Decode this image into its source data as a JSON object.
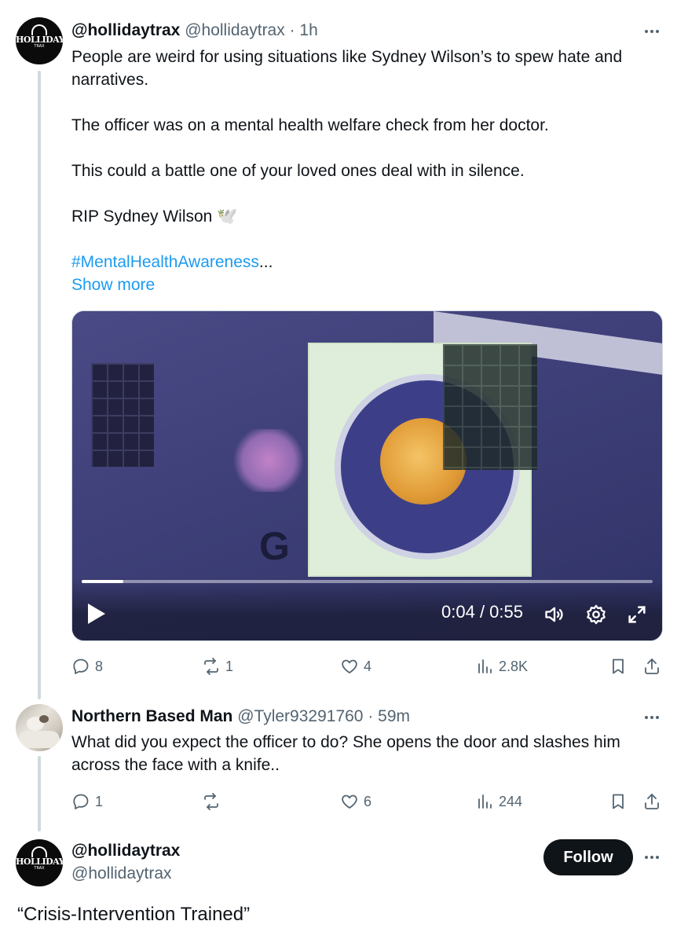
{
  "post": {
    "display_name": "@hollidaytrax",
    "handle": "@hollidaytrax",
    "time": "· 1h",
    "paragraphs": [
      "People are weird for using situations like Sydney Wilson’s to spew hate and narratives.",
      "The officer was on a mental health welfare check from her doctor.",
      "This could a battle one of your loved ones deal with in silence.",
      "RIP Sydney Wilson 🕊️"
    ],
    "hashtag": "#MentalHealthAwareness",
    "ellipsis": "...",
    "show_more": "Show more",
    "avatar": {
      "logo_text": "HOLLIDAY",
      "logo_sub": "TRAX"
    },
    "video": {
      "current_time": "0:04",
      "separator": " / ",
      "duration": "0:55",
      "progress": 0.073,
      "sign_small_letter": "G"
    },
    "actions": {
      "replies": "8",
      "reposts": "1",
      "likes": "4",
      "views": "2.8K"
    }
  },
  "reply": {
    "display_name": "Northern Based Man",
    "handle": "@Tyler93291760",
    "time": "· 59m",
    "text": "What did you expect the officer to do? She opens the door and slashes him across the face with a knife..",
    "actions": {
      "replies": "1",
      "reposts": "",
      "likes": "6",
      "views": "244"
    }
  },
  "next_post": {
    "display_name": "@hollidaytrax",
    "handle": "@hollidaytrax",
    "follow_label": "Follow",
    "text": "“Crisis-Intervention Trained”"
  },
  "colors": {
    "link": "#1d9bf0",
    "text": "#0f1419",
    "secondary": "#536471",
    "thread_line": "#cfd9de"
  },
  "icons": [
    "reply-icon",
    "repost-icon",
    "like-icon",
    "views-icon",
    "bookmark-icon",
    "share-icon",
    "more-icon",
    "play-icon",
    "volume-icon",
    "settings-icon",
    "fullscreen-icon"
  ]
}
